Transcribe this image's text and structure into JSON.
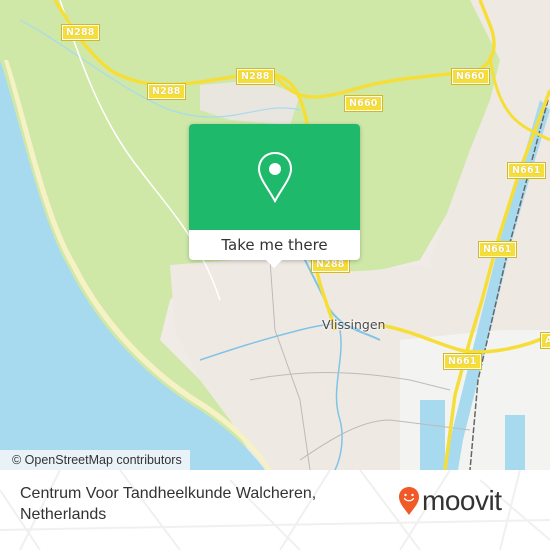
{
  "map": {
    "colors": {
      "water": "#a8daef",
      "land_urban": "#f0ebe7",
      "land_green": "#cfe8a8",
      "beach": "#f7f1c6",
      "road_major": "#f6de3a",
      "accent": "#1fb96c"
    },
    "road_shields": [
      {
        "id": "n288-a",
        "label": "N288"
      },
      {
        "id": "n288-b",
        "label": "N288"
      },
      {
        "id": "n288-c",
        "label": "N288"
      },
      {
        "id": "n288-d",
        "label": "N288"
      },
      {
        "id": "n660-a",
        "label": "N660"
      },
      {
        "id": "n660-b",
        "label": "N660"
      },
      {
        "id": "n661-a",
        "label": "N661"
      },
      {
        "id": "n661-b",
        "label": "N661"
      },
      {
        "id": "n661-c",
        "label": "N661"
      },
      {
        "id": "a-edge",
        "label": "A"
      }
    ],
    "place_labels": [
      {
        "id": "vlissingen",
        "label": "Vlissingen"
      }
    ],
    "attribution": "© OpenStreetMap contributors"
  },
  "popup": {
    "icon": "map-pin-icon",
    "cta_label": "Take me there"
  },
  "footer": {
    "place_name": "Centrum Voor Tandheelkunde Walcheren, Netherlands",
    "brand": "moovit",
    "brand_icon": "moovit-pin-smile-icon"
  }
}
